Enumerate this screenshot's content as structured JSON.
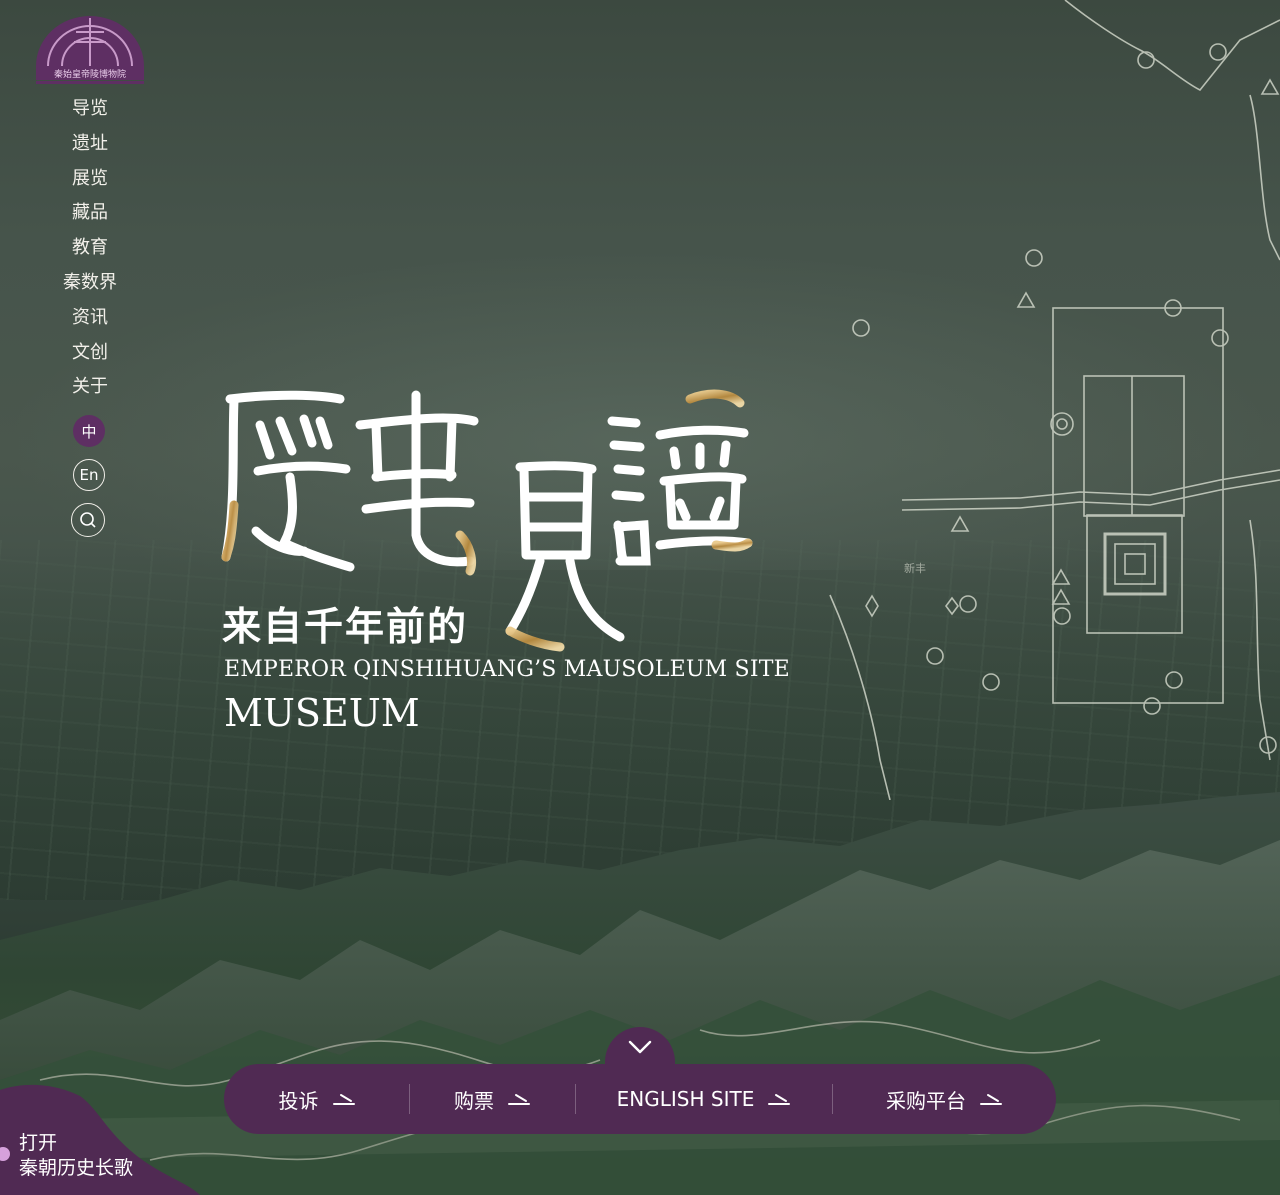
{
  "brand": {
    "logo_icon": "museum-emblem-icon",
    "logo_text": "秦始皇帝陵博物院"
  },
  "nav": {
    "items": [
      "导览",
      "遗址",
      "展览",
      "藏品",
      "教育",
      "秦数界",
      "资讯",
      "文创",
      "关于"
    ]
  },
  "language": {
    "zh": "中",
    "en": "En",
    "search_icon": "search-icon"
  },
  "hero": {
    "calligraphy": "歷史見證",
    "subtitle": "来自千年前的",
    "english_line1": "EMPEROR QINSHIHUANG’S MAUSOLEUM SITE",
    "english_line2": "MUSEUM"
  },
  "map_overlay": {
    "place_label": "新丰"
  },
  "bottom_bar": {
    "scroll_icon": "chevron-down-icon",
    "items": [
      "投诉",
      "购票",
      "ENGLISH SITE",
      "采购平台"
    ],
    "arrow_icon": "arrow-right-icon"
  },
  "music": {
    "line1": "打开",
    "line2": "秦朝历史长歌"
  },
  "colors": {
    "brand_purple": "#502a53",
    "accent_purple": "#5e2f63",
    "gold": "#c8a15a",
    "text": "#ffffff"
  }
}
